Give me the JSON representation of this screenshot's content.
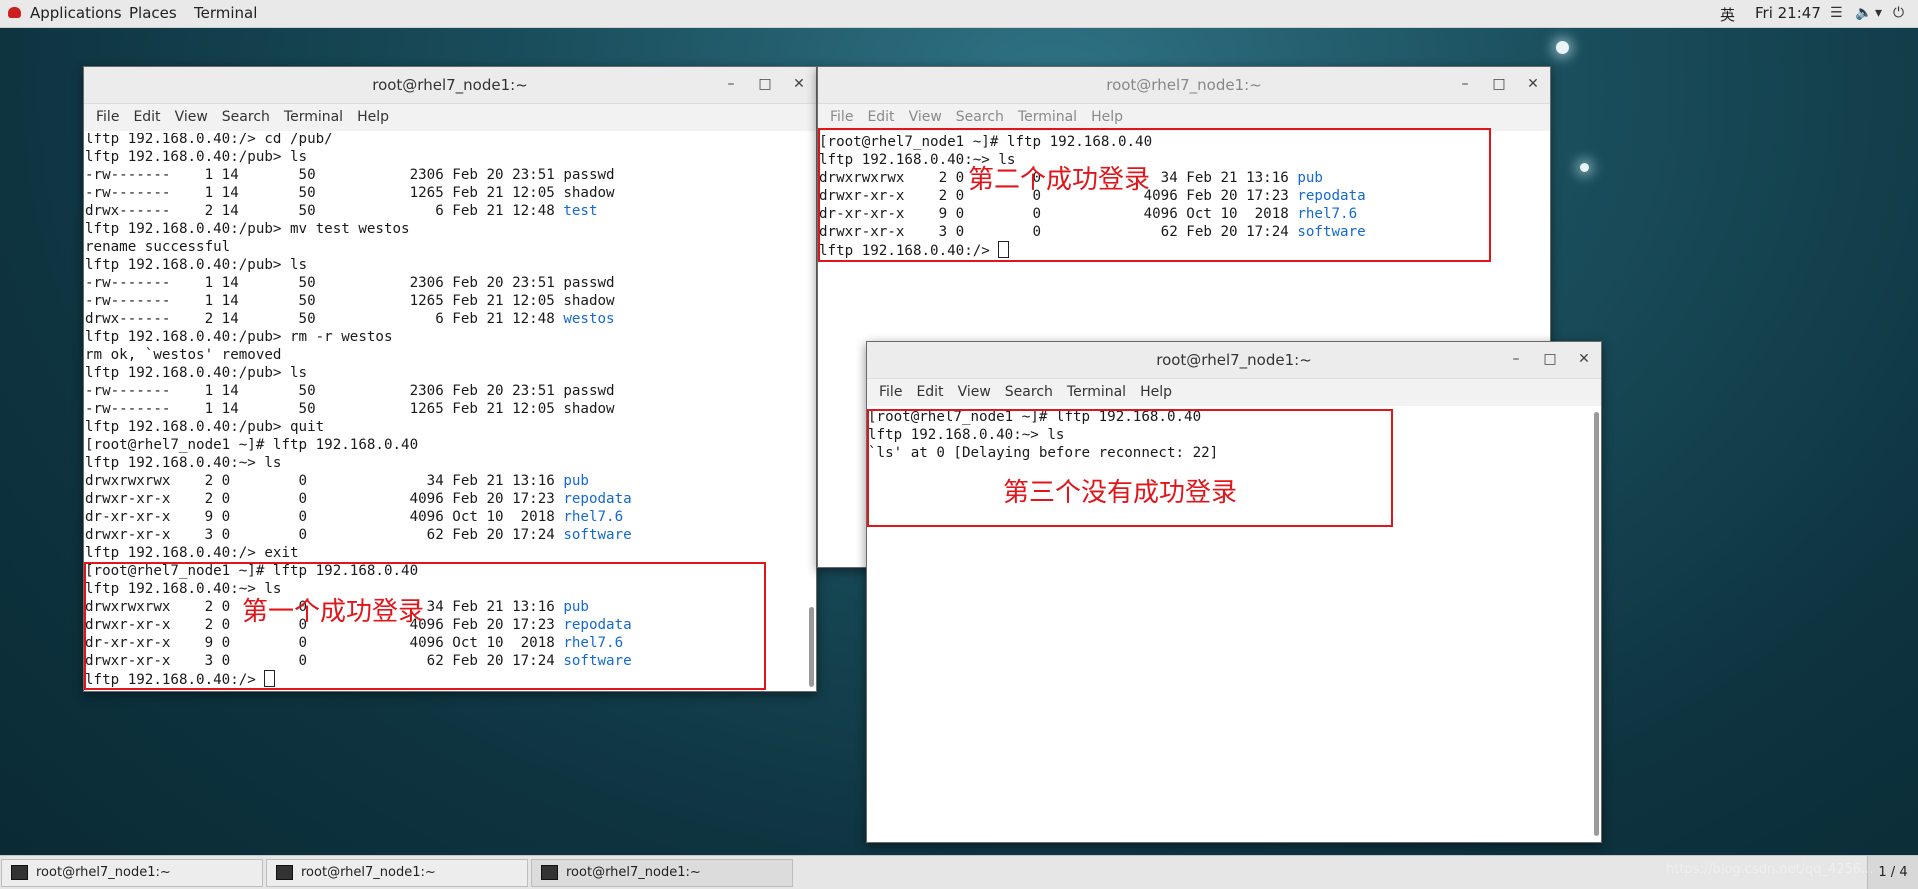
{
  "topbar": {
    "applications": "Applications",
    "places": "Places",
    "terminal": "Terminal",
    "input_method": "英",
    "clock": "Fri 21:47"
  },
  "menu": [
    "File",
    "Edit",
    "View",
    "Search",
    "Terminal",
    "Help"
  ],
  "windows": [
    {
      "title": "root@rhel7_node1:~",
      "lines": [
        {
          "t": "lftp 192.168.0.40:/> cd /pub/"
        },
        {
          "t": "lftp 192.168.0.40:/pub> ls"
        },
        {
          "t": "-rw-------    1 14       50           2306 Feb 20 23:51 passwd"
        },
        {
          "t": "-rw-------    1 14       50           1265 Feb 21 12:05 shadow"
        },
        {
          "t": "drwx------    2 14       50              6 Feb 21 12:48 ",
          "b": "test"
        },
        {
          "t": "lftp 192.168.0.40:/pub> mv test westos"
        },
        {
          "t": "rename successful"
        },
        {
          "t": "lftp 192.168.0.40:/pub> ls"
        },
        {
          "t": "-rw-------    1 14       50           2306 Feb 20 23:51 passwd"
        },
        {
          "t": "-rw-------    1 14       50           1265 Feb 21 12:05 shadow"
        },
        {
          "t": "drwx------    2 14       50              6 Feb 21 12:48 ",
          "b": "westos"
        },
        {
          "t": "lftp 192.168.0.40:/pub> rm -r westos"
        },
        {
          "t": "rm ok, `westos' removed"
        },
        {
          "t": "lftp 192.168.0.40:/pub> ls"
        },
        {
          "t": "-rw-------    1 14       50           2306 Feb 20 23:51 passwd"
        },
        {
          "t": "-rw-------    1 14       50           1265 Feb 21 12:05 shadow"
        },
        {
          "t": "lftp 192.168.0.40:/pub> quit"
        },
        {
          "t": "[root@rhel7_node1 ~]# lftp 192.168.0.40"
        },
        {
          "t": "lftp 192.168.0.40:~> ls"
        },
        {
          "t": "drwxrwxrwx    2 0        0              34 Feb 21 13:16 ",
          "b": "pub"
        },
        {
          "t": "drwxr-xr-x    2 0        0            4096 Feb 20 17:23 ",
          "b": "repodata"
        },
        {
          "t": "dr-xr-xr-x    9 0        0            4096 Oct 10  2018 ",
          "b": "rhel7.6"
        },
        {
          "t": "drwxr-xr-x    3 0        0              62 Feb 20 17:24 ",
          "b": "software"
        },
        {
          "t": "lftp 192.168.0.40:/> exit"
        },
        {
          "t": "[root@rhel7_node1 ~]# lftp 192.168.0.40"
        },
        {
          "t": "lftp 192.168.0.40:~> ls"
        },
        {
          "t": "drwxrwxrwx    2 0        0              34 Feb 21 13:16 ",
          "b": "pub"
        },
        {
          "t": "drwxr-xr-x    2 0        0            4096 Feb 20 17:23 ",
          "b": "repodata"
        },
        {
          "t": "dr-xr-xr-x    9 0        0            4096 Oct 10  2018 ",
          "b": "rhel7.6"
        },
        {
          "t": "drwxr-xr-x    3 0        0              62 Feb 20 17:24 ",
          "b": "software"
        },
        {
          "t": "lftp 192.168.0.40:/> ",
          "cursor": true
        }
      ],
      "annotation": "第一个成功登录"
    },
    {
      "title": "root@rhel7_node1:~",
      "lines": [
        {
          "t": "[root@rhel7_node1 ~]# lftp 192.168.0.40"
        },
        {
          "t": "lftp 192.168.0.40:~> ls"
        },
        {
          "t": "drwxrwxrwx    2 0        0              34 Feb 21 13:16 ",
          "b": "pub"
        },
        {
          "t": "drwxr-xr-x    2 0        0            4096 Feb 20 17:23 ",
          "b": "repodata"
        },
        {
          "t": "dr-xr-xr-x    9 0        0            4096 Oct 10  2018 ",
          "b": "rhel7.6"
        },
        {
          "t": "drwxr-xr-x    3 0        0              62 Feb 20 17:24 ",
          "b": "software"
        },
        {
          "t": "lftp 192.168.0.40:/> ",
          "cursor": true
        }
      ],
      "annotation": "第二个成功登录"
    },
    {
      "title": "root@rhel7_node1:~",
      "lines": [
        {
          "t": "[root@rhel7_node1 ~]# lftp 192.168.0.40"
        },
        {
          "t": "lftp 192.168.0.40:~> ls"
        },
        {
          "t": "`ls' at 0 [Delaying before reconnect: 22]"
        }
      ],
      "annotation": "第三个没有成功登录"
    }
  ],
  "taskbar": {
    "tasks": [
      "root@rhel7_node1:~",
      "root@rhel7_node1:~",
      "root@rhel7_node1:~"
    ],
    "pager": "1 / 4",
    "watermark": "https://blog.csdn.net/qq_4256..."
  },
  "colors": {
    "annotation_red": "#e0161b",
    "directory_blue": "#1469d2"
  }
}
